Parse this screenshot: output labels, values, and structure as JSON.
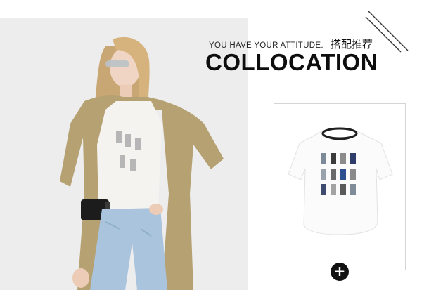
{
  "header": {
    "tagline": "YOU HAVE YOUR ATTITUDE.",
    "chinese_title": "搭配推荐",
    "title": "COLLOCATION"
  },
  "model_photo": {
    "icon": "model-photo-illustration"
  },
  "product": {
    "icon": "white-graphic-tshirt-illustration"
  },
  "add_button": {
    "label": "+",
    "icon": "plus-icon"
  },
  "colors": {
    "title_text": "#0e0e0e",
    "card_border": "#d4d4d4",
    "button_bg": "#111111",
    "button_fg": "#ffffff",
    "photo_bg": "#ececec"
  }
}
